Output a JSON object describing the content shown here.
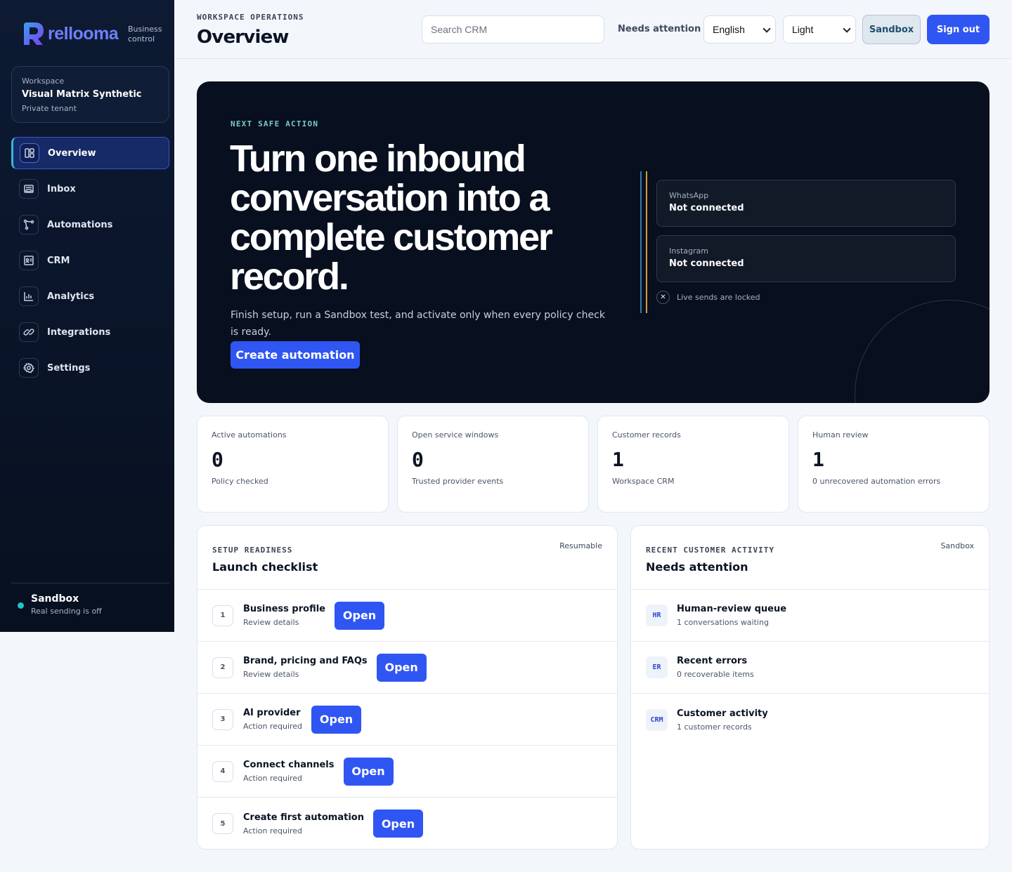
{
  "brand": {
    "name": "rellooma",
    "subtitle": "Business control"
  },
  "workspace": {
    "label": "Workspace",
    "name": "Visual Matrix Synthetic",
    "tenant": "Private tenant"
  },
  "nav": [
    {
      "label": "Overview",
      "icon": "layout-icon",
      "active": true
    },
    {
      "label": "Inbox",
      "icon": "inbox-icon"
    },
    {
      "label": "Automations",
      "icon": "flow-icon"
    },
    {
      "label": "CRM",
      "icon": "contact-card-icon"
    },
    {
      "label": "Analytics",
      "icon": "bar-chart-icon"
    },
    {
      "label": "Integrations",
      "icon": "link-icon"
    },
    {
      "label": "Settings",
      "icon": "gear-icon"
    }
  ],
  "sidebar_footer": {
    "title": "Sandbox",
    "subtitle": "Real sending is off"
  },
  "header": {
    "eyebrow": "WORKSPACE OPERATIONS",
    "title": "Overview",
    "search_placeholder": "Search CRM",
    "needs_attention": "Needs attention",
    "language": "English",
    "theme": "Light",
    "sandbox_label": "Sandbox",
    "signout_label": "Sign out"
  },
  "hero": {
    "eyebrow": "NEXT SAFE ACTION",
    "title": "Turn one inbound conversation into a complete customer record.",
    "description": "Finish setup, run a Sandbox test, and activate only when every policy check is ready.",
    "cta": "Create automation",
    "channels": [
      {
        "name": "WhatsApp",
        "status": "Not connected"
      },
      {
        "name": "Instagram",
        "status": "Not connected"
      }
    ],
    "lock_text": "Live sends are locked"
  },
  "stats": [
    {
      "label": "Active automations",
      "value": "0",
      "sub": "Policy checked"
    },
    {
      "label": "Open service windows",
      "value": "0",
      "sub": "Trusted provider events"
    },
    {
      "label": "Customer records",
      "value": "1",
      "sub": "Workspace CRM"
    },
    {
      "label": "Human review",
      "value": "1",
      "sub": "0 unrecovered automation errors"
    }
  ],
  "checklist": {
    "eyebrow": "SETUP READINESS",
    "title": "Launch checklist",
    "tag": "Resumable",
    "open_label": "Open",
    "items": [
      {
        "num": "1",
        "title": "Business profile",
        "sub": "Review details"
      },
      {
        "num": "2",
        "title": "Brand, pricing and FAQs",
        "sub": "Review details"
      },
      {
        "num": "3",
        "title": "AI provider",
        "sub": "Action required"
      },
      {
        "num": "4",
        "title": "Connect channels",
        "sub": "Action required"
      },
      {
        "num": "5",
        "title": "Create first automation",
        "sub": "Action required"
      }
    ]
  },
  "activity": {
    "eyebrow": "RECENT CUSTOMER ACTIVITY",
    "title": "Needs attention",
    "tag": "Sandbox",
    "items": [
      {
        "badge": "HR",
        "title": "Human-review queue",
        "sub": "1 conversations waiting"
      },
      {
        "badge": "ER",
        "title": "Recent errors",
        "sub": "0 recoverable items"
      },
      {
        "badge": "CRM",
        "title": "Customer activity",
        "sub": "1 customer records"
      }
    ]
  },
  "colors": {
    "accent": "#2f56f2",
    "sidebar": "#0d1a33",
    "hero_bg": "#080f1e",
    "status_dot": "#22c0c8"
  }
}
